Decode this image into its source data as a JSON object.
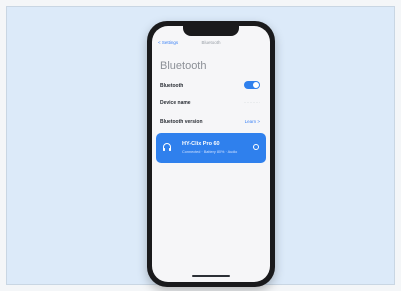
{
  "navbar": {
    "back_label": "< Settings",
    "title": "Bluetooth"
  },
  "page": {
    "title": "Bluetooth"
  },
  "settings": {
    "bluetooth_label": "Bluetooth",
    "bluetooth_on": true,
    "device_name_label": "Device name",
    "device_name_value": "···········",
    "version_label": "Bluetooth version",
    "version_link": "Learn >"
  },
  "device": {
    "name": "HY-Clix Pro 60",
    "subtitle": "Connected · Battery 80% · Audio",
    "icon": "headphones-icon"
  },
  "colors": {
    "accent": "#2f80ed",
    "background": "#dceaf9"
  }
}
